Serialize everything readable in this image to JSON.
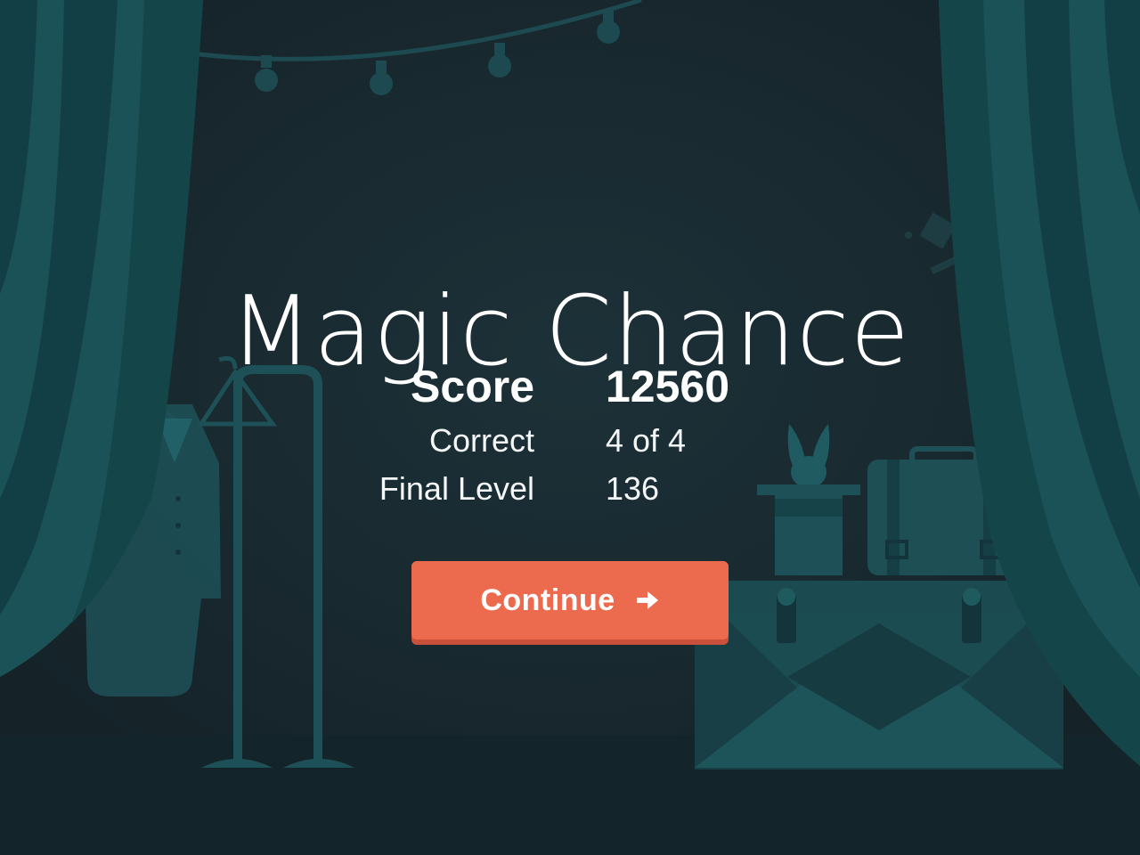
{
  "game": {
    "title": "Magic Chance"
  },
  "results": {
    "score_label": "Score",
    "score_value": "12560",
    "correct_label": "Correct",
    "correct_value": "4 of 4",
    "level_label": "Final Level",
    "level_value": "136"
  },
  "actions": {
    "continue_label": "Continue",
    "continue_icon": "arrow-right-icon"
  },
  "colors": {
    "background": "#1a2c33",
    "curtain": "#1a5257",
    "curtain_stripe": "#123f45",
    "props": "#1d5157",
    "button": "#ec6b4f",
    "text": "#ffffff"
  }
}
